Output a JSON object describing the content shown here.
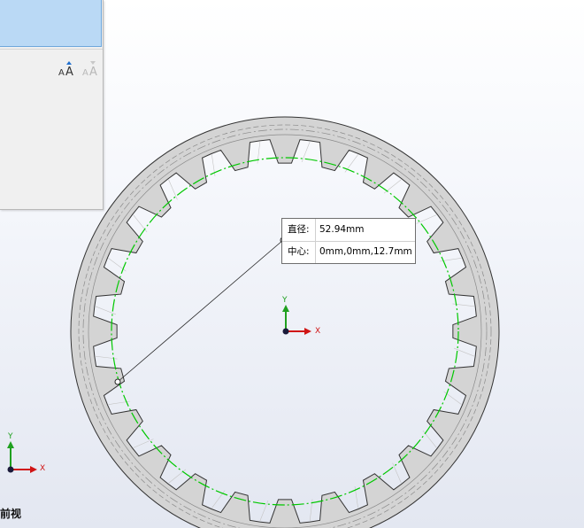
{
  "tooltip": {
    "diameter_label": "直径:",
    "diameter_value": "52.94mm",
    "center_label": "中心:",
    "center_value": "0mm,0mm,12.7mm"
  },
  "triad": {
    "x_label": "X",
    "y_label": "Y"
  },
  "view": {
    "name": "前视"
  },
  "panel": {
    "font_icon": "font-size-icon",
    "font_icon_disabled": "font-size-disabled-icon"
  },
  "colors": {
    "axis_x": "#d01414",
    "axis_y": "#1fa01f",
    "sketch_circle": "#00c800",
    "selection": "#bad9f5",
    "gear_fill": "#d4d4d4"
  },
  "gear": {
    "teeth": 24
  }
}
